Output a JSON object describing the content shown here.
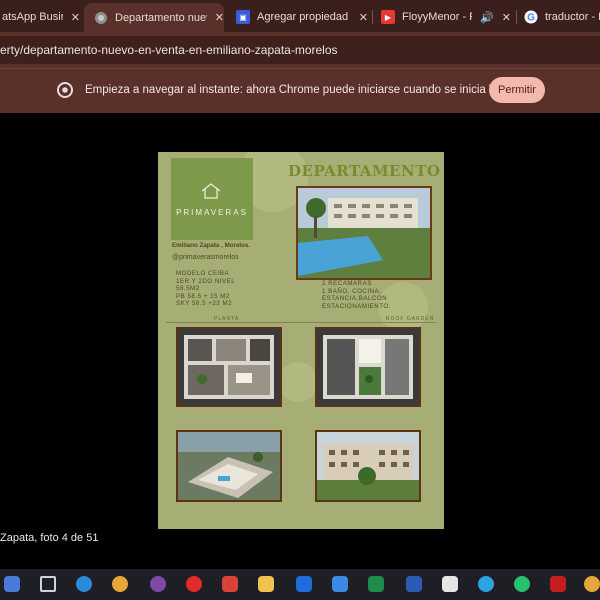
{
  "browser": {
    "tabs": [
      {
        "label": "atsApp Busin",
        "icon": "whatsapp-business-icon",
        "active": false
      },
      {
        "label": "Departamento nuevo",
        "icon": "globe-icon",
        "active": true
      },
      {
        "label": "Agregar propiedad |",
        "icon": "site-favicon-icon",
        "active": false
      },
      {
        "label": "FloyyMenor - Peli",
        "icon": "youtube-icon",
        "active": false
      },
      {
        "label": "traductor - Bu",
        "icon": "google-icon",
        "active": false
      }
    ],
    "url": "erty/departamento-nuevo-en-venta-en-emiliano-zapata-morelos",
    "infobar_text": "Empieza a navegar al instante: ahora Chrome puede iniciarse cuando se inicia Windows.",
    "permit_label": "Permitir"
  },
  "viewer": {
    "caption": "Zapata, foto 4 de 51"
  },
  "flyer": {
    "brand": "PRIMAVERAS",
    "title": "DEPARTAMENTO",
    "location": "Emiliano Zapata , Morelos.",
    "handle": "@primaverasmorelos",
    "model_lines": [
      "MODELO CEIBA",
      "1ER Y 2DO NIVEL",
      "58.5M2",
      "PB 58.5 + 15 M2",
      "SKY 58.5 +23 M2"
    ],
    "feature_lines": [
      "2 RECAMARAS",
      "1 BAÑO, COCINA,",
      "ESTANCIA,BALCON",
      "ESTACIONAMIENTO."
    ],
    "plan_label_left": "PLANTA",
    "plan_label_right": "ROOF GARDEN"
  },
  "taskbar": {
    "icons": [
      "windows-start-icon",
      "task-view-icon",
      "edge-icon",
      "chrome-icon",
      "tor-icon",
      "opera-icon",
      "snipping-tool-icon",
      "file-explorer-icon",
      "outlook-icon",
      "file-icon",
      "excel-icon",
      "word-icon",
      "settings-gear-icon",
      "telegram-icon",
      "whatsapp-icon",
      "mcafee-icon",
      "chrome-profile-icon"
    ]
  },
  "colors": {
    "tabstrip": "#3b1f1c",
    "toolbar": "#5a302b",
    "permit_button": "#f4b9ad",
    "flyer_bg": "#a6ae76",
    "title_color": "#7c8a2e"
  }
}
